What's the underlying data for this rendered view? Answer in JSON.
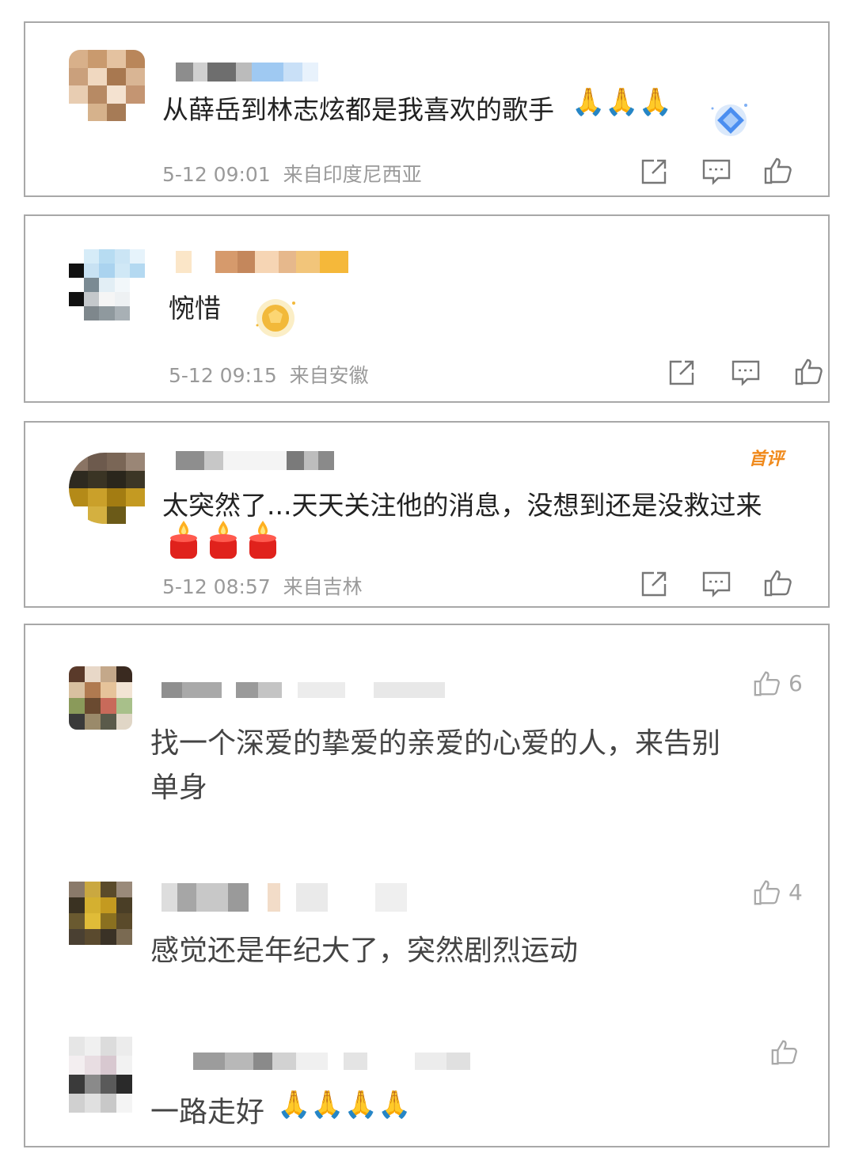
{
  "comments": [
    {
      "text": "从薛岳到林志炫都是我喜欢的歌手",
      "emoji": "🙏🙏🙏",
      "time": "5-12 09:01",
      "location": "来自印度尼西亚",
      "icons": [
        "share-icon",
        "comment-icon",
        "like-icon"
      ]
    },
    {
      "text": "惋惜",
      "time": "5-12 09:15",
      "location": "来自安徽",
      "icons": [
        "share-icon",
        "comment-icon",
        "like-icon"
      ]
    },
    {
      "text": "太突然了...天天关注他的消息，没想到还是没救过来",
      "tag": "首评",
      "time": "5-12 08:57",
      "location": "来自吉林",
      "icons": [
        "share-icon",
        "comment-icon",
        "like-icon"
      ]
    }
  ],
  "replies": [
    {
      "line1": "找一个深爱的挚爱的亲爱的心爱的人，来告别",
      "line2": "单身",
      "likes": "6"
    },
    {
      "line1": "感觉还是年纪大了，突然剧烈运动",
      "likes": "4"
    },
    {
      "line1": "一路走好",
      "emoji": "🙏🙏🙏🙏"
    }
  ],
  "colors": {
    "border": "#a8a8a8",
    "meta": "#9a9a9a",
    "tag": "#f08a1c"
  }
}
